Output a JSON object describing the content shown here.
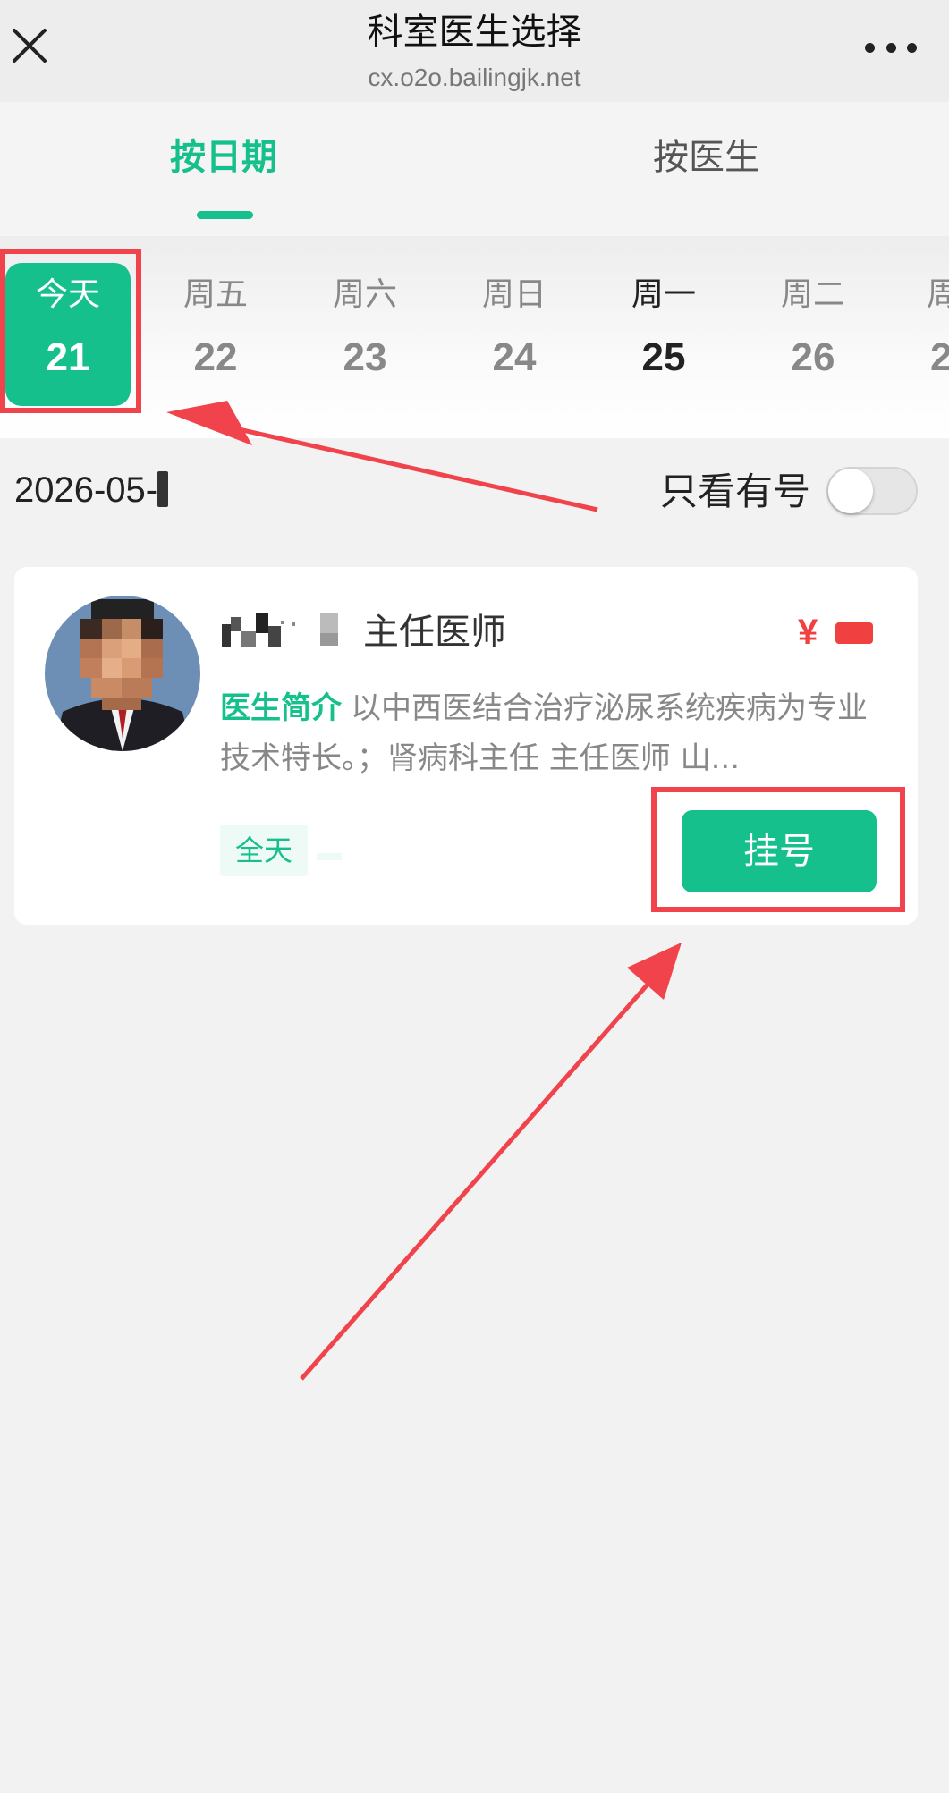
{
  "header": {
    "title": "科室医生选择",
    "url": "cx.o2o.bailingjk.net",
    "close_icon": "close-icon",
    "more_icon": "more-dots-icon"
  },
  "tabs": [
    {
      "label": "按日期",
      "active": true
    },
    {
      "label": "按医生",
      "active": false
    }
  ],
  "dates": [
    {
      "weekday": "今天",
      "day": "21",
      "selected": true
    },
    {
      "weekday": "周五",
      "day": "22"
    },
    {
      "weekday": "周六",
      "day": "23"
    },
    {
      "weekday": "周日",
      "day": "24"
    },
    {
      "weekday": "周一",
      "day": "25",
      "emphasis": true
    },
    {
      "weekday": "周二",
      "day": "26"
    },
    {
      "weekday": "周",
      "day": "2"
    }
  ],
  "filter": {
    "date_text": "2026-05-",
    "available_only_label": "只看有号",
    "available_only_on": false
  },
  "doctor": {
    "title": "主任医师",
    "price_symbol": "¥",
    "intro_label": "医生简介",
    "intro_text": "以中西医结合治疗泌尿系统疾病为专业技术特长。；肾病科主任 主任医师 山...",
    "schedule_tag": "全天",
    "register_label": "挂号"
  },
  "colors": {
    "accent": "#16c08c",
    "annotation": "#f0434b",
    "price": "#f04040"
  }
}
